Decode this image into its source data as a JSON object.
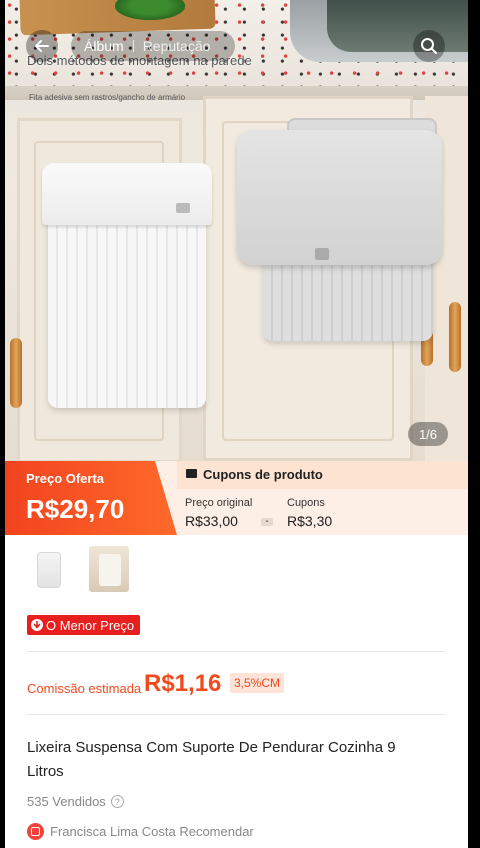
{
  "header": {
    "tabs": [
      {
        "label": "Álbum",
        "active": true
      },
      {
        "label": "Reputação",
        "active": false
      }
    ],
    "page_indicator": "1/6"
  },
  "hero": {
    "overlay_title": "Dois métodos de montagem na parede",
    "overlay_subtitle": "Fita adesiva sem rastros/gancho de armário"
  },
  "price": {
    "offer_label": "Preço Oferta",
    "offer_value": "R$29,70",
    "coupon_label": "Cupons de produto",
    "original_label": "Preço original",
    "original_value": "R$33,00",
    "minus_symbol": "-",
    "coupons_label": "Cupons",
    "coupons_value": "R$3,30"
  },
  "badge": {
    "lowest_price": "O Menor Preço"
  },
  "commission": {
    "label": "Comissão estimada",
    "value": "R$1,16",
    "rate": "3,5%CM"
  },
  "product": {
    "title": "Lixeira Suspensa Com Suporte De Pendurar Cozinha 9 Litros",
    "sold": "535 Vendidos",
    "recommender": "Francisca Lima Costa Recomendar"
  },
  "colors": {
    "accent": "#f04a1e",
    "badge_red": "#e81f1f",
    "offer_gradient_start": "#f2431f",
    "coupon_bg": "#fdeee6"
  },
  "icons": {
    "back": "back-arrow-icon",
    "search": "search-icon",
    "coupon": "coupon-ticket-icon",
    "down_arrow": "down-arrow-icon",
    "help": "help-circle-icon",
    "recommend": "recommend-icon"
  }
}
